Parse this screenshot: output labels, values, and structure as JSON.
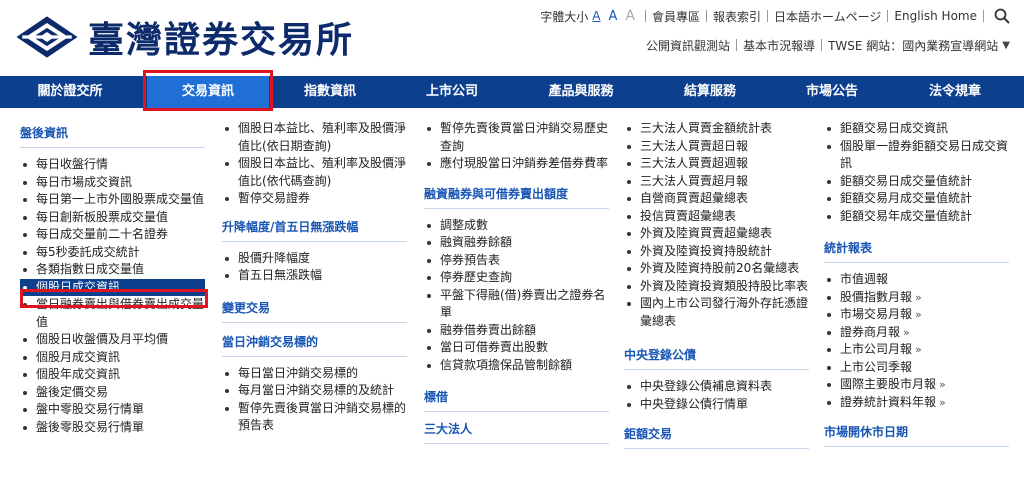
{
  "header": {
    "logo_text": "臺灣證券交易所",
    "font_size_label": "字體大小",
    "font_sizes": [
      "A",
      "A",
      "A"
    ],
    "links_row1": [
      "會員專區",
      "報表索引",
      "日本語ホームページ",
      "English Home"
    ],
    "links_row2": [
      "公開資訊觀測站",
      "基本市況報導",
      "TWSE 網站：國內業務宣導網站"
    ]
  },
  "nav": {
    "items": [
      "關於證交所",
      "交易資訊",
      "指數資訊",
      "上市公司",
      "產品與服務",
      "結算服務",
      "市場公告",
      "法令規章"
    ],
    "active_index": 1
  },
  "col1": {
    "heading": "盤後資訊",
    "items": [
      "每日收盤行情",
      "每日市場成交資訊",
      "每日第一上市外國股票成交量值",
      "每日創新板股票成交量值",
      "每日成交量前二十名證券",
      "每5秒委託成交統計",
      "各類指數日成交量值",
      "個股日成交資訊",
      "當日融券賣出與借券賣出成交量值",
      "個股日收盤價及月平均價",
      "個股月成交資訊",
      "個股年成交資訊",
      "盤後定價交易",
      "盤中零股交易行情單",
      "盤後零股交易行情單"
    ],
    "active_index": 7
  },
  "col2": {
    "items_top": [
      "個股日本益比、殖利率及股價淨值比(依日期查詢)",
      "個股日本益比、殖利率及股價淨值比(依代碼查詢)",
      "暫停交易證券"
    ],
    "section1_heading": "升降幅度/首五日無漲跌幅",
    "section1_items": [
      "股價升降幅度",
      "首五日無漲跌幅"
    ],
    "section2_heading": "變更交易",
    "section3_heading": "當日沖銷交易標的",
    "section3_items": [
      "每日當日沖銷交易標的",
      "每月當日沖銷交易標的及統計",
      "暫停先賣後買當日沖銷交易標的預告表"
    ]
  },
  "col3": {
    "items_top": [
      "暫停先賣後買當日沖銷交易歷史查詢",
      "應付現股當日沖銷券差借券費率"
    ],
    "section1_heading": "融資融券與可借券賣出額度",
    "section1_items": [
      "調整成數",
      "融資融券餘額",
      "停券預告表",
      "停券歷史查詢",
      "平盤下得融(借)券賣出之證券名單",
      "融券借券賣出餘額",
      "當日可借券賣出股數",
      "信貸款項擔保品管制餘額"
    ],
    "section2_heading": "標借",
    "section3_heading": "三大法人"
  },
  "col4": {
    "items_top": [
      "三大法人買賣金額統計表",
      "三大法人買賣超日報",
      "三大法人買賣超週報",
      "三大法人買賣超月報",
      "自營商買賣超彙總表",
      "投信買賣超彙總表",
      "外資及陸資買賣超彙總表",
      "外資及陸資投資持股統計",
      "外資及陸資持股前20名彙總表",
      "外資及陸資投資類股持股比率表",
      "國內上市公司發行海外存託憑證彙總表"
    ],
    "section1_heading": "中央登錄公債",
    "section1_items": [
      "中央登錄公債補息資料表",
      "中央登錄公債行情單"
    ],
    "section2_heading": "鉅額交易"
  },
  "col5": {
    "items_top": [
      "鉅額交易日成交資訊",
      "個股單一證券鉅額交易日成交資訊",
      "鉅額交易日成交量值統計",
      "鉅額交易月成交量值統計",
      "鉅額交易年成交量值統計"
    ],
    "section1_heading": "統計報表",
    "section1_items": [
      "市值週報",
      "股價指數月報",
      "市場交易月報",
      "證券商月報",
      "上市公司月報",
      "上市公司季報",
      "國際主要股市月報",
      "證券統計資料年報"
    ],
    "section1_arrows": [
      false,
      true,
      true,
      true,
      true,
      false,
      true,
      true
    ],
    "section2_heading": "市場開休市日期"
  }
}
